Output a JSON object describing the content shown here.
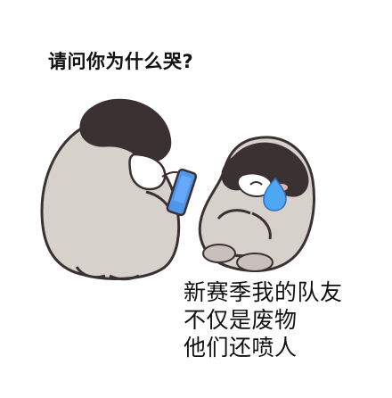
{
  "meme": {
    "question": "请问你为什么哭?",
    "answer_lines": [
      "新赛季我的队友",
      "不仅是废物",
      "他们还喷人"
    ]
  },
  "colors": {
    "background": "#ffffff",
    "outline": "#3b3032",
    "body_gray": "#d7d1cc",
    "head_dark": "#3a3133",
    "phone_blue": "#4f95ea",
    "tear_blue": "#4da7f2",
    "blush": "#f3c1c1",
    "feet": "#c8c0bb"
  },
  "icons": [
    "standing-penguin-icon",
    "phone-icon",
    "crying-penguin-icon",
    "tear-icon"
  ]
}
